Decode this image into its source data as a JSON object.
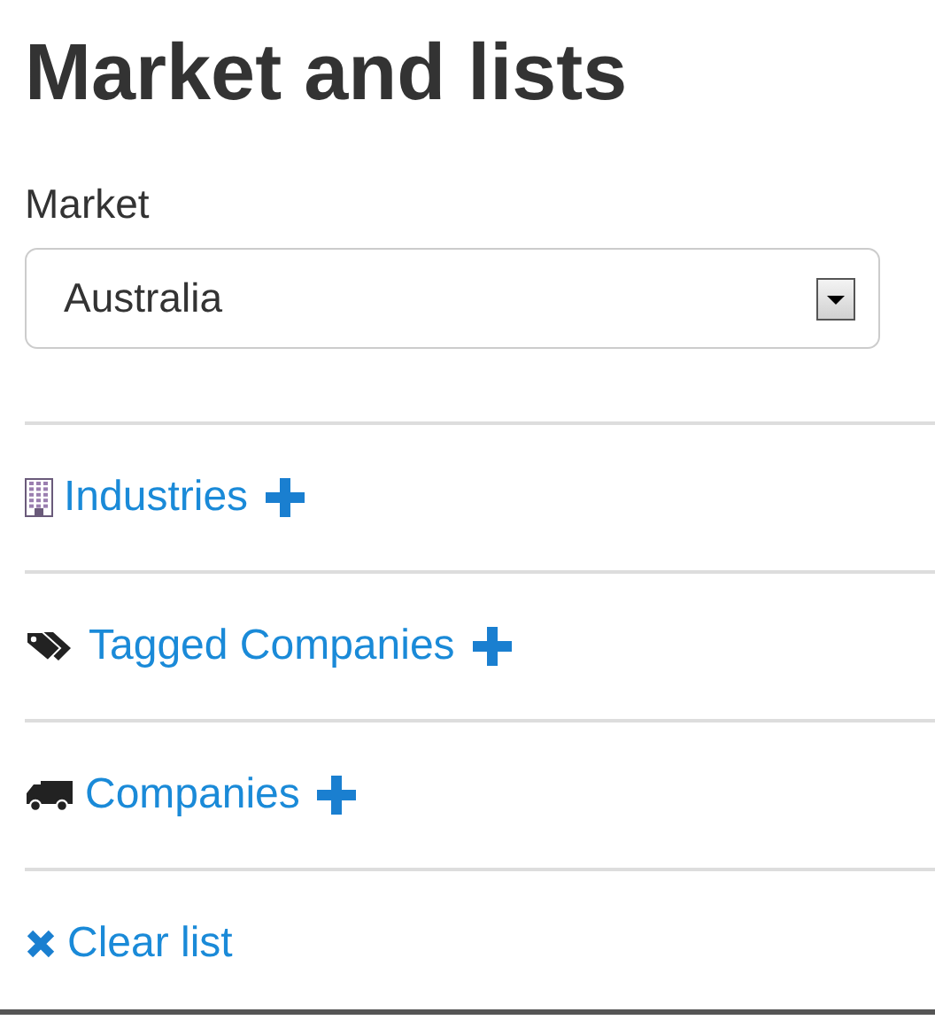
{
  "title": "Market and lists",
  "market": {
    "label": "Market",
    "value": "Australia"
  },
  "lists": [
    {
      "kind": "industries",
      "label": "Industries",
      "addable": true
    },
    {
      "kind": "tags",
      "label": "Tagged Companies",
      "addable": true
    },
    {
      "kind": "companies",
      "label": "Companies",
      "addable": true
    },
    {
      "kind": "clear",
      "label": "Clear list",
      "addable": false
    }
  ]
}
